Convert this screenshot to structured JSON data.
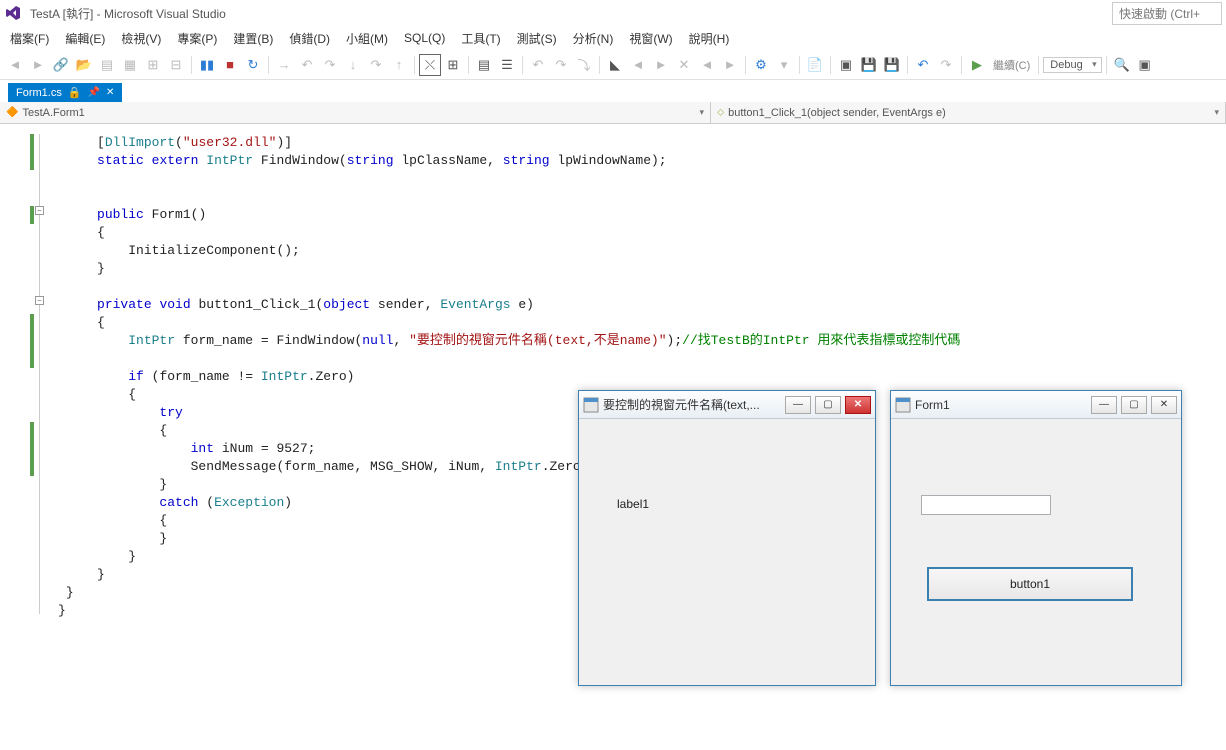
{
  "title_bar": {
    "title": "TestA [執行] - Microsoft Visual Studio",
    "quick_launch_placeholder": "快速啟動 (Ctrl+"
  },
  "menu": {
    "items": [
      "檔案(F)",
      "編輯(E)",
      "檢視(V)",
      "專案(P)",
      "建置(B)",
      "偵錯(D)",
      "小組(M)",
      "SQL(Q)",
      "工具(T)",
      "測試(S)",
      "分析(N)",
      "視窗(W)",
      "說明(H)"
    ]
  },
  "toolbar": {
    "continue_label": "繼續(C)",
    "config_label": "Debug"
  },
  "tab": {
    "filename": "Form1.cs",
    "pinned": true
  },
  "nav": {
    "class_name": "TestA.Form1",
    "method_name": "button1_Click_1(object sender, EventArgs e)"
  },
  "code": {
    "attr_open": "[",
    "attr_name": "DllImport",
    "attr_arg": "\"user32.dll\"",
    "attr_close": ")]",
    "kw_static": "static",
    "kw_extern": "extern",
    "type_intptr": "IntPtr",
    "fn_findwindow": "FindWindow(",
    "kw_string": "string",
    "param_lpclass": "lpClassName, ",
    "param_lpwin": "lpWindowName);",
    "kw_public": "public",
    "ctor_name": "Form1()",
    "init_call": "InitializeComponent();",
    "kw_private": "private",
    "kw_void": "void",
    "handler_name": "button1_Click_1(",
    "kw_object": "object",
    "param_sender": "sender, ",
    "type_eventargs": "EventArgs",
    "param_e": " e)",
    "var_formname": "form_name = FindWindow(",
    "kw_null": "null",
    "str_title": "\"要控制的視窗元件名稱(text,不是name)\"",
    "close_paren": ");",
    "comment_find": "//找TestB的IntPtr 用來代表指標或控制代碼",
    "kw_if": "if",
    "cond": "(form_name != ",
    "zero": ".Zero)",
    "kw_try": "try",
    "kw_int": "int",
    "inum_decl": "iNum = 9527;",
    "send_call": "SendMessage(form_name, MSG_SHOW, iNum, ",
    "send_close": ".Zero);",
    "kw_catch": "catch",
    "catch_param": "(",
    "type_exception": "Exception",
    "catch_close": ")",
    "brace_open": "{",
    "brace_close": "}"
  },
  "window1": {
    "title": "要控制的視窗元件名稱(text,...",
    "label": "label1"
  },
  "window2": {
    "title": "Form1",
    "button_label": "button1"
  }
}
